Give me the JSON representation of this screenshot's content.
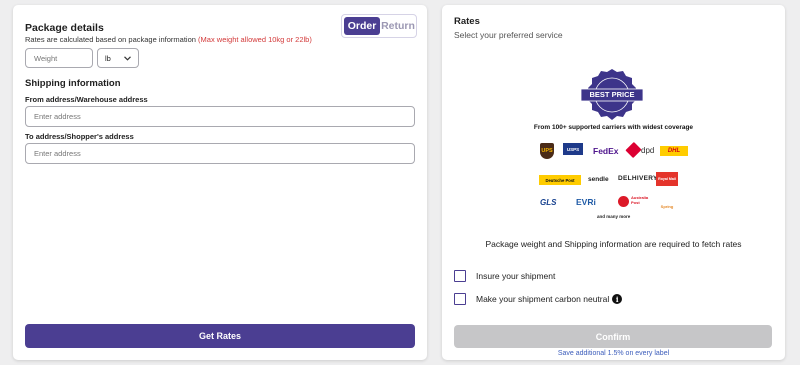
{
  "package": {
    "title": "Package details",
    "subtitle": "Rates are calculated based on package information",
    "warning": "(Max weight allowed 10kg or 22lb)",
    "weight_placeholder": "Weight",
    "unit": "lb"
  },
  "toggle": {
    "order": "Order",
    "return": "Return",
    "selected": "Order"
  },
  "shipping": {
    "title": "Shipping information",
    "from_label": "From address/Warehouse address",
    "from_placeholder": "Enter address",
    "to_label": "To address/Shopper's address",
    "to_placeholder": "Enter address"
  },
  "get_rates": "Get Rates",
  "rates": {
    "title": "Rates",
    "subtitle": "Select your preferred service",
    "badge_text": "BEST PRICE",
    "coverage": "From 100+ supported carriers with widest coverage",
    "carriers": [
      "UPS",
      "USPS",
      "FedEx",
      "dpd",
      "DHL",
      "Deutsche Post",
      "sendle",
      "DELHIVERY",
      "Royal Mail",
      "GLS",
      "EVRi",
      "Australia Post",
      "Spring"
    ],
    "many_more": "and many more",
    "required_msg": "Package weight and Shipping information are required to fetch rates",
    "insure": "Insure your shipment",
    "carbon": "Make your shipment carbon neutral",
    "confirm": "Confirm",
    "save_link": "Save additional 1.5% on every label"
  },
  "colors": {
    "primary": "#4b3e92",
    "warning": "#d33a3a",
    "link": "#3c5dbb",
    "disabled": "#c6c6c8"
  }
}
